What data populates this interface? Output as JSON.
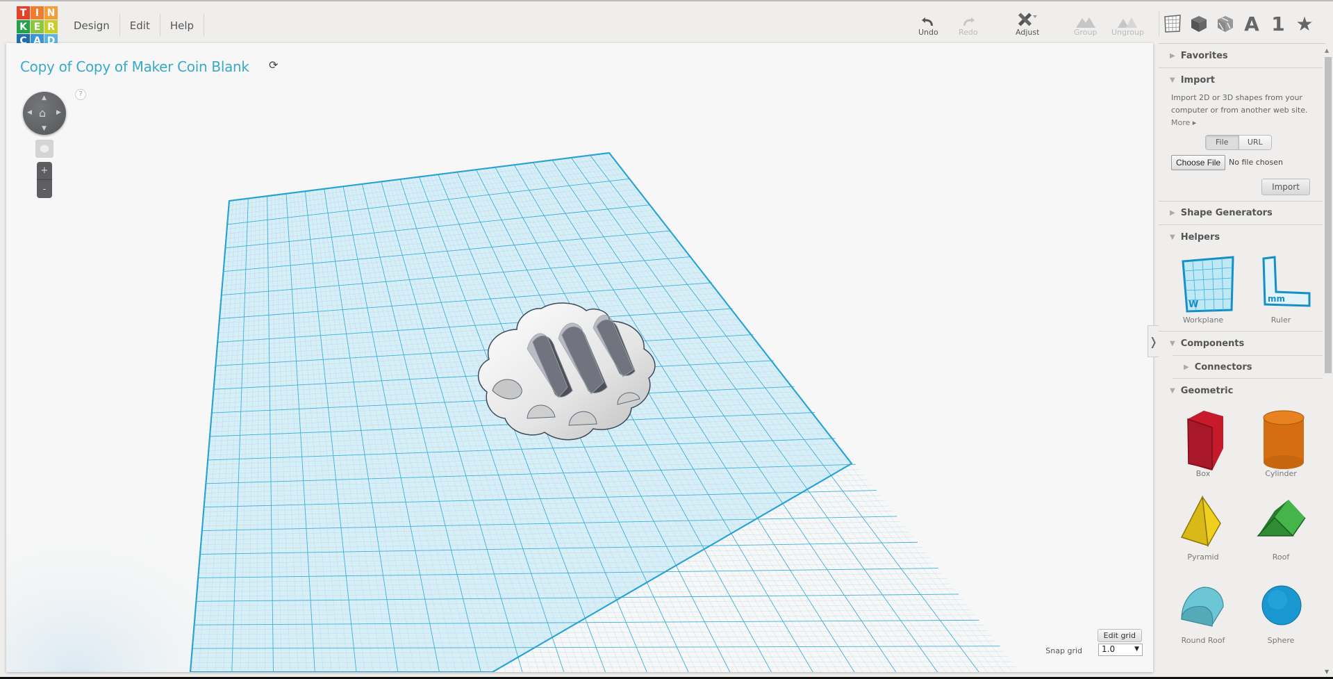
{
  "app": {
    "logo_letters": [
      "T",
      "I",
      "N",
      "K",
      "E",
      "R",
      "C",
      "A",
      "D"
    ],
    "logo_colors": [
      "#e2412a",
      "#f07c2e",
      "#f39e3b",
      "#25a249",
      "#8cc63f",
      "#c9cf2a",
      "#1f6db0",
      "#3b97d3",
      "#5db4e0"
    ]
  },
  "menu": [
    {
      "label": "Design"
    },
    {
      "label": "Edit"
    },
    {
      "label": "Help"
    }
  ],
  "toolbar": {
    "undo": {
      "label": "Undo",
      "icon": "undo-icon",
      "enabled": true
    },
    "redo": {
      "label": "Redo",
      "icon": "redo-icon",
      "enabled": false
    },
    "adjust": {
      "label": "Adjust",
      "icon": "adjust-icon",
      "enabled": true
    },
    "group": {
      "label": "Group",
      "icon": "group-icon",
      "enabled": false
    },
    "ungroup": {
      "label": "Ungroup",
      "icon": "ungroup-icon",
      "enabled": false
    }
  },
  "view_icons": [
    {
      "name": "workplane-view-icon",
      "glyph": "grid"
    },
    {
      "name": "solid-view-icon",
      "glyph": "cube"
    },
    {
      "name": "hole-view-icon",
      "glyph": "striped-cube"
    },
    {
      "name": "text-shapes-icon",
      "glyph": "A"
    },
    {
      "name": "number-shapes-icon",
      "glyph": "1"
    },
    {
      "name": "favorites-star-icon",
      "glyph": "★"
    }
  ],
  "design": {
    "title": "Copy of Copy of Maker Coin Blank",
    "refresh_icon": "⟳"
  },
  "viewport": {
    "help": "?",
    "zoom_in": "+",
    "zoom_out": "-",
    "edit_grid_label": "Edit grid",
    "snap_grid_label": "Snap grid",
    "snap_grid_value": "1.0",
    "accent_color": "#39a9c8"
  },
  "sidebar": {
    "favorites": "Favorites",
    "import": {
      "title": "Import",
      "description": "Import 2D or 3D shapes from your computer or from another web site.",
      "more": "More ▸",
      "toggle": [
        "File",
        "URL"
      ],
      "selected_toggle": "File",
      "choose_file": "Choose File",
      "no_file": "No file chosen",
      "import_button": "Import"
    },
    "shape_generators": "Shape Generators",
    "helpers": {
      "title": "Helpers",
      "items": [
        {
          "label": "Workplane"
        },
        {
          "label": "Ruler"
        }
      ]
    },
    "components": "Components",
    "connectors": "Connectors",
    "geometric": {
      "title": "Geometric",
      "items": [
        {
          "label": "Box",
          "color": "#c4172c"
        },
        {
          "label": "Cylinder",
          "color": "#e07a1c"
        },
        {
          "label": "Pyramid",
          "color": "#e8c51a"
        },
        {
          "label": "Roof",
          "color": "#36a83e"
        },
        {
          "label": "Round Roof",
          "color": "#5bbfd0"
        },
        {
          "label": "Sphere",
          "color": "#1a9ad6"
        }
      ]
    }
  }
}
